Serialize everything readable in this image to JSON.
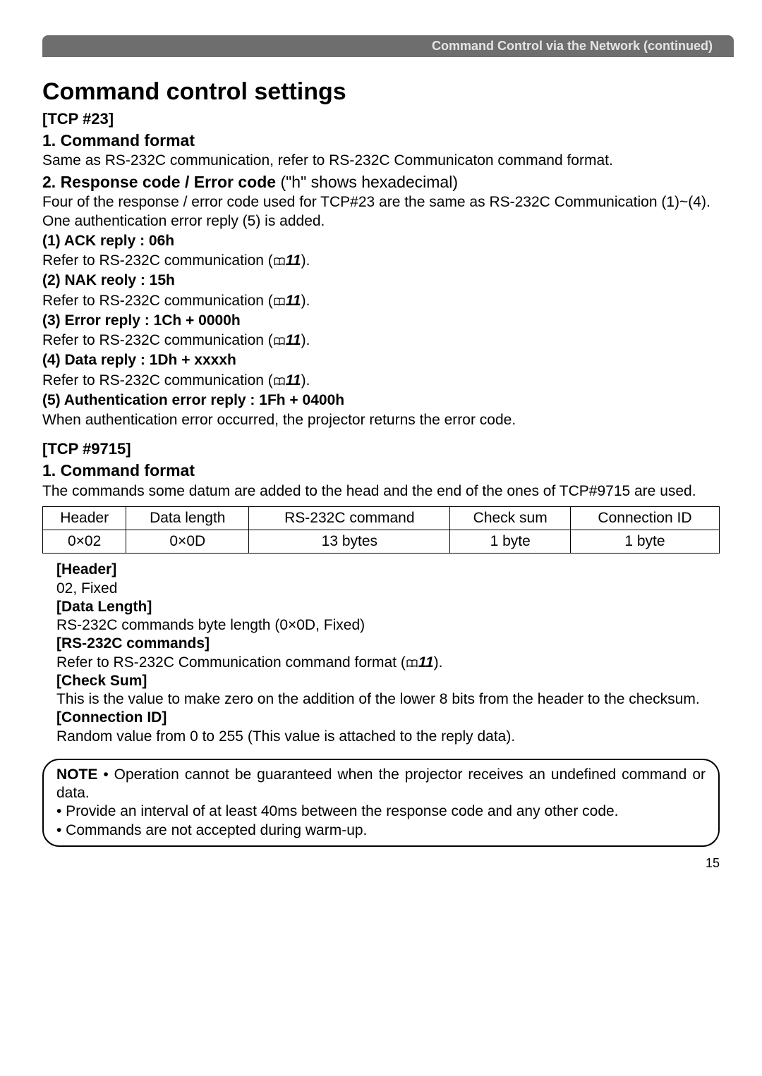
{
  "banner": "Command Control via the Network (continued)",
  "h1": "Command control settings",
  "tcp23": "[TCP #23]",
  "s1": "1. Command format",
  "s1_body": "Same as RS-232C communication, refer to RS-232C Communicaton command format.",
  "s2": "2. Response code / Error code",
  "s2_tail": " (\"h\" shows hexadecimal)",
  "s2_body_a": "Four of the response / error code used for TCP#23 are the same as RS-232C Communication (1)~(4). One authentication error reply (5) is added.",
  "items": [
    {
      "head": "(1) ACK reply : 06h",
      "body_pre": "Refer to RS-232C communication (",
      "ref": "11",
      "body_post": ")."
    },
    {
      "head": "(2) NAK reoly : 15h",
      "body_pre": "Refer to RS-232C communication (",
      "ref": "11",
      "body_post": ")."
    },
    {
      "head": "(3) Error reply : 1Ch + 0000h",
      "body_pre": "Refer to RS-232C communication (",
      "ref": "11",
      "body_post": ")."
    },
    {
      "head": "(4) Data reply : 1Dh + xxxxh",
      "body_pre": "Refer to RS-232C communication (",
      "ref": "11",
      "body_post": ")."
    }
  ],
  "item5_head": "(5) Authentication error reply : 1Fh + 0400h",
  "item5_body": "When authentication error occurred, the projector returns the error code.",
  "tcp9715": "[TCP #9715]",
  "s3": "1. Command format",
  "s3_body": "The commands some datum are added to the head and the end of the ones of TCP#9715 are used.",
  "chart_data": {
    "type": "table",
    "headers": [
      "Header",
      "Data length",
      "RS-232C command",
      "Check sum",
      "Connection ID"
    ],
    "row": [
      "0×02",
      "0×0D",
      "13 bytes",
      "1 byte",
      "1 byte"
    ]
  },
  "defs": {
    "header_t": "[Header]",
    "header_b": "02, Fixed",
    "dl_t": "[Data Length]",
    "dl_b": "RS-232C commands byte length (0×0D, Fixed)",
    "rs_t": "[RS-232C commands]",
    "rs_b_pre": "Refer to RS-232C Communication command format (",
    "rs_ref": "11",
    "rs_b_post": ").",
    "cs_t": "[Check Sum]",
    "cs_b": "This is the value to make zero on the addition of the lower 8 bits from the header to the checksum.",
    "cid_t": "[Connection ID]",
    "cid_b": "Random value from 0 to 255 (This value is attached to the reply data)."
  },
  "note_label": "NOTE",
  "note_1": " • Operation cannot be guaranteed when the projector receives an undefined command or data.",
  "note_2": "• Provide an interval of at least 40ms between the response code and any other code.",
  "note_3": " • Commands are not accepted during warm-up.",
  "page_number": "15"
}
